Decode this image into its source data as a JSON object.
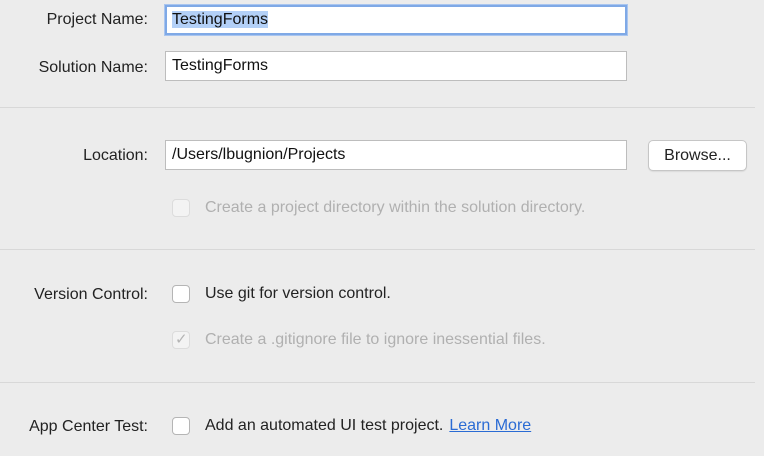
{
  "project": {
    "label": "Project Name:",
    "value": "TestingForms"
  },
  "solution": {
    "label": "Solution Name:",
    "value": "TestingForms"
  },
  "location": {
    "label": "Location:",
    "value": "/Users/lbugnion/Projects",
    "browse_label": "Browse...",
    "create_dir_label": "Create a project directory within the solution directory.",
    "create_dir_checked": false,
    "create_dir_enabled": false
  },
  "version_control": {
    "label": "Version Control:",
    "use_git_label": "Use git for version control.",
    "use_git_checked": false,
    "gitignore_label": "Create a .gitignore file to ignore inessential files.",
    "gitignore_checked": true,
    "gitignore_enabled": false
  },
  "app_center": {
    "label": "App Center Test:",
    "add_test_label": "Add an automated UI test project.",
    "add_test_checked": false,
    "learn_more_label": "Learn More"
  },
  "colors": {
    "background": "#ececec",
    "focus_ring": "#7fa9e6",
    "selection": "#b3d0f7",
    "link": "#2a6bd4"
  }
}
